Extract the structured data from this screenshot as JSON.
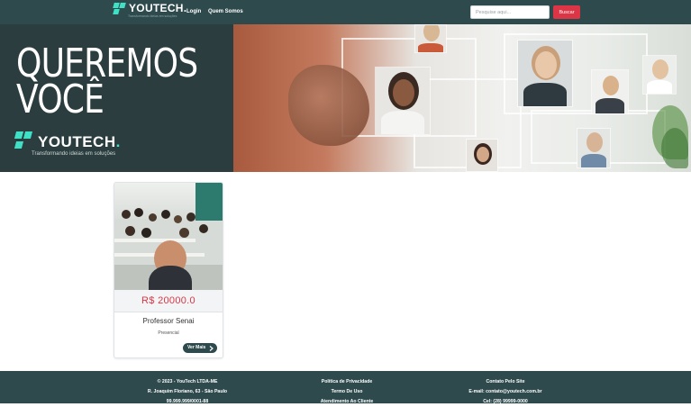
{
  "navbar": {
    "brand_name": "YOUTECH.",
    "brand_tagline": "Transformando ideias em soluções",
    "links": [
      {
        "label": "Login"
      },
      {
        "label": "Quem Somos"
      }
    ],
    "search": {
      "placeholder": "Pesquise aqui...",
      "value": ""
    },
    "search_button": "Buscar"
  },
  "hero": {
    "title_line1": "QUEREMOS",
    "title_line2": "VOCÊ",
    "logo_text": "YOUTECH",
    "logo_dot": ".",
    "tagline": "Transformando ideias em soluções"
  },
  "cards": [
    {
      "price": "R$ 20000.0",
      "title": "Professor Senai",
      "mode": "Presencial",
      "button": "Ver Mais",
      "button_icon": "chevron-right-icon"
    }
  ],
  "footer": {
    "company": [
      "© 2023 - YouTech LTDA-ME",
      "R. Joaquim Floriano, 63 - São Paulo",
      "99.999.999/0001-88"
    ],
    "links": [
      "Política de Privacidade",
      "Termo De Uso",
      "Atendimento Ao Cliente"
    ],
    "contact": [
      "Contato Pelo Site",
      "E-mail: contato@youtech.com.br",
      "Cel: (28) 99999-0000"
    ]
  },
  "colors": {
    "navbar": "#2e4a4d",
    "accent": "#3ee0c6",
    "price": "#dc3545",
    "search_button": "#dc3545"
  }
}
